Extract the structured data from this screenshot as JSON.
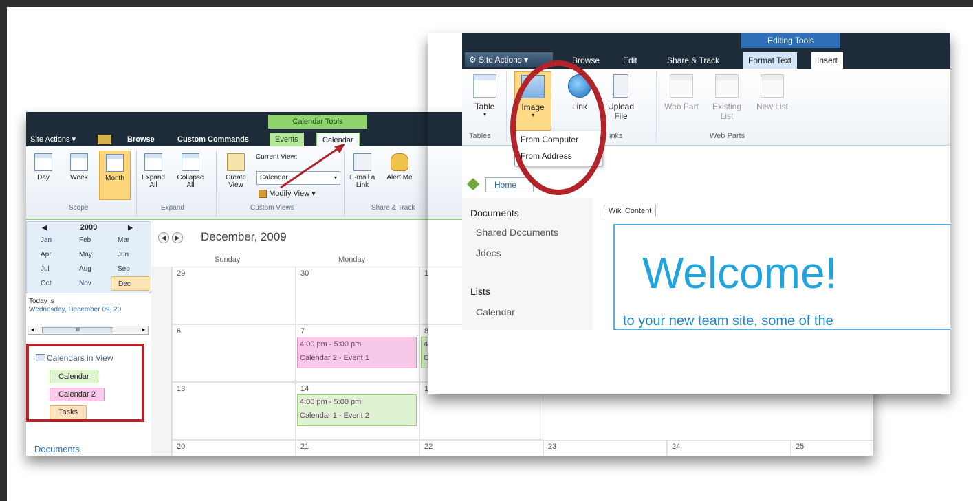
{
  "calendar_view": {
    "ribbon": {
      "site_actions": "Site Actions",
      "tabs": [
        "Browse",
        "Custom Commands",
        "Events",
        "Calendar"
      ],
      "context_group": "Calendar Tools",
      "buttons": {
        "day": "Day",
        "week": "Week",
        "month": "Month",
        "expand_all": "Expand All",
        "collapse_all": "Collapse All",
        "create_view": "Create View",
        "current_view_label": "Current View:",
        "current_view_value": "Calendar",
        "modify_view": "Modify View",
        "email_link": "E-mail a Link",
        "alert_me": "Alert Me"
      },
      "groups": {
        "scope": "Scope",
        "expand": "Expand",
        "custom_views": "Custom Views",
        "share_track": "Share & Track"
      }
    },
    "date_picker": {
      "year": "2009",
      "months": [
        "Jan",
        "Feb",
        "Mar",
        "Apr",
        "May",
        "Jun",
        "Jul",
        "Aug",
        "Sep",
        "Oct",
        "Nov",
        "Dec"
      ],
      "selected": "Dec"
    },
    "today_label": "Today is",
    "today_date": "Wednesday, December 09, 20",
    "scroll_mid": "III",
    "calendars_in_view": {
      "title": "Calendars in View",
      "items": [
        {
          "label": "Calendar",
          "bg": "#dff3d2",
          "border": "#9bcf7a"
        },
        {
          "label": "Calendar 2",
          "bg": "#f8c8e8",
          "border": "#e38fc6"
        },
        {
          "label": "Tasks",
          "bg": "#fde2c0",
          "border": "#e8b078"
        }
      ]
    },
    "documents_link": "Documents",
    "month_title": "December, 2009",
    "weekdays": [
      "Sunday",
      "Monday"
    ],
    "rows": [
      [
        "29",
        "30",
        "1"
      ],
      [
        "6",
        "7",
        "8"
      ],
      [
        "13",
        "14",
        "1"
      ],
      [
        "20",
        "21",
        "22",
        "23",
        "24",
        "25"
      ]
    ],
    "events": [
      {
        "time": "4:00 pm - 5:00 pm",
        "title": "Calendar 2 - Event 1",
        "bg": "#f8c8e8",
        "border": "#e38fc6"
      },
      {
        "time": "4:00 pm - 5:00 pm",
        "title": "Calendar 1 - Event 2",
        "bg": "#dff3d2",
        "border": "#9bcf7a"
      }
    ],
    "event_partial": [
      "4",
      "C"
    ]
  },
  "edit_view": {
    "site_actions": "Site Actions",
    "tabs": [
      "Browse",
      "Edit",
      "Share & Track",
      "Format Text",
      "Insert"
    ],
    "context_group": "Editing Tools",
    "buttons": {
      "table": "Table",
      "image": "Image",
      "link": "Link",
      "upload_file": "Upload File",
      "web_part": "Web Part",
      "existing_list": "Existing List",
      "new_list": "New List"
    },
    "groups": {
      "tables": "Tables",
      "links": "inks",
      "web_parts": "Web Parts"
    },
    "image_menu": [
      "From Computer",
      "From Address"
    ],
    "home": "Home",
    "quick_launch": {
      "documents_heading": "Documents",
      "documents": [
        "Shared Documents",
        "Jdocs"
      ],
      "lists_heading": "Lists",
      "lists": [
        "Calendar"
      ]
    },
    "wiki_tab": "Wiki Content",
    "welcome": "Welcome!",
    "subtitle": "to your new team site, some of the"
  },
  "colors": {
    "highlight_circle": "#b2232a",
    "ribbon_dark": "#1e2b38",
    "welcome_blue": "#21a3e0"
  }
}
